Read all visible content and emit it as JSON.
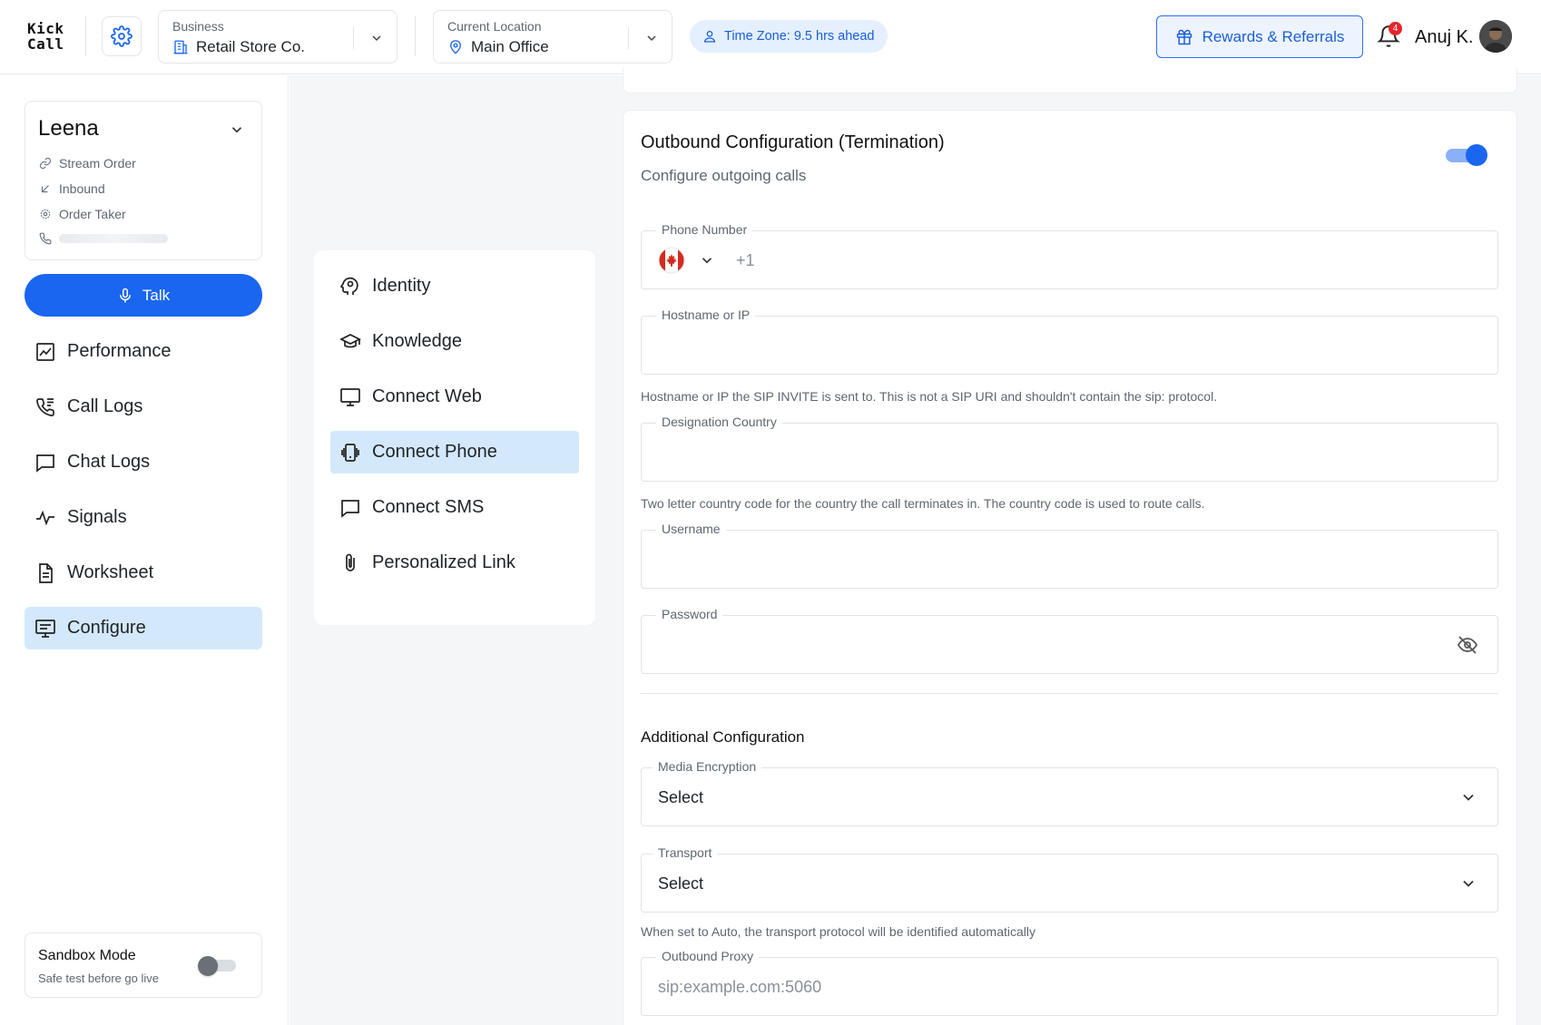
{
  "app": {
    "logo_line1": "Kick",
    "logo_line2": "Call"
  },
  "header": {
    "business": {
      "label": "Business",
      "value": "Retail Store Co."
    },
    "location": {
      "label": "Current Location",
      "value": "Main Office"
    },
    "timezone": "Time Zone: 9.5 hrs ahead",
    "rewards_label": "Rewards & Referrals",
    "notification_count": "4",
    "user_name": "Anuj K."
  },
  "agent": {
    "name": "Leena",
    "details": [
      {
        "icon": "link-icon",
        "text": "Stream Order"
      },
      {
        "icon": "inbound-arrow-icon",
        "text": "Inbound"
      },
      {
        "icon": "settings-icon",
        "text": "Order Taker"
      }
    ],
    "talk_label": "Talk"
  },
  "nav": [
    {
      "label": "Performance",
      "icon": "chart-icon",
      "active": false
    },
    {
      "label": "Call Logs",
      "icon": "phone-log-icon",
      "active": false
    },
    {
      "label": "Chat Logs",
      "icon": "chat-icon",
      "active": false
    },
    {
      "label": "Signals",
      "icon": "pulse-icon",
      "active": false
    },
    {
      "label": "Worksheet",
      "icon": "document-icon",
      "active": false
    },
    {
      "label": "Configure",
      "icon": "configure-icon",
      "active": true
    }
  ],
  "sandbox": {
    "title": "Sandbox Mode",
    "subtitle": "Safe test before go live",
    "enabled": false
  },
  "submenu": [
    {
      "label": "Identity",
      "icon": "identity-icon",
      "active": false
    },
    {
      "label": "Knowledge",
      "icon": "graduation-cap-icon",
      "active": false
    },
    {
      "label": "Connect Web",
      "icon": "monitor-icon",
      "active": false
    },
    {
      "label": "Connect Phone",
      "icon": "vibrating-phone-icon",
      "active": true
    },
    {
      "label": "Connect SMS",
      "icon": "message-icon",
      "active": false
    },
    {
      "label": "Personalized Link",
      "icon": "paperclip-icon",
      "active": false
    }
  ],
  "outbound": {
    "title": "Outbound Configuration (Termination)",
    "subtitle": "Configure outgoing calls",
    "enabled": true,
    "phone": {
      "label": "Phone Number",
      "country_code": "+1",
      "flag": "canada-flag-icon"
    },
    "hostname": {
      "label": "Hostname or IP",
      "help": "Hostname or IP the SIP INVITE is sent to. This is not a SIP URI and shouldn't contain the sip: protocol."
    },
    "country": {
      "label": "Designation Country",
      "help": "Two letter country code for the country the call terminates in. The country code is used to route calls."
    },
    "username": {
      "label": "Username"
    },
    "password": {
      "label": "Password"
    },
    "additional_title": "Additional Configuration",
    "media_encryption": {
      "label": "Media Encryption",
      "value": "Select"
    },
    "transport": {
      "label": "Transport",
      "value": "Select",
      "help": "When set to Auto, the transport protocol will be identified automatically"
    },
    "outbound_proxy": {
      "label": "Outbound Proxy",
      "placeholder": "sip:example.com:5060"
    }
  },
  "colors": {
    "accent": "#1a66f0",
    "active_bg": "#d4e8fb",
    "badge": "#e5252a",
    "canvas": "#f5f6f8"
  }
}
